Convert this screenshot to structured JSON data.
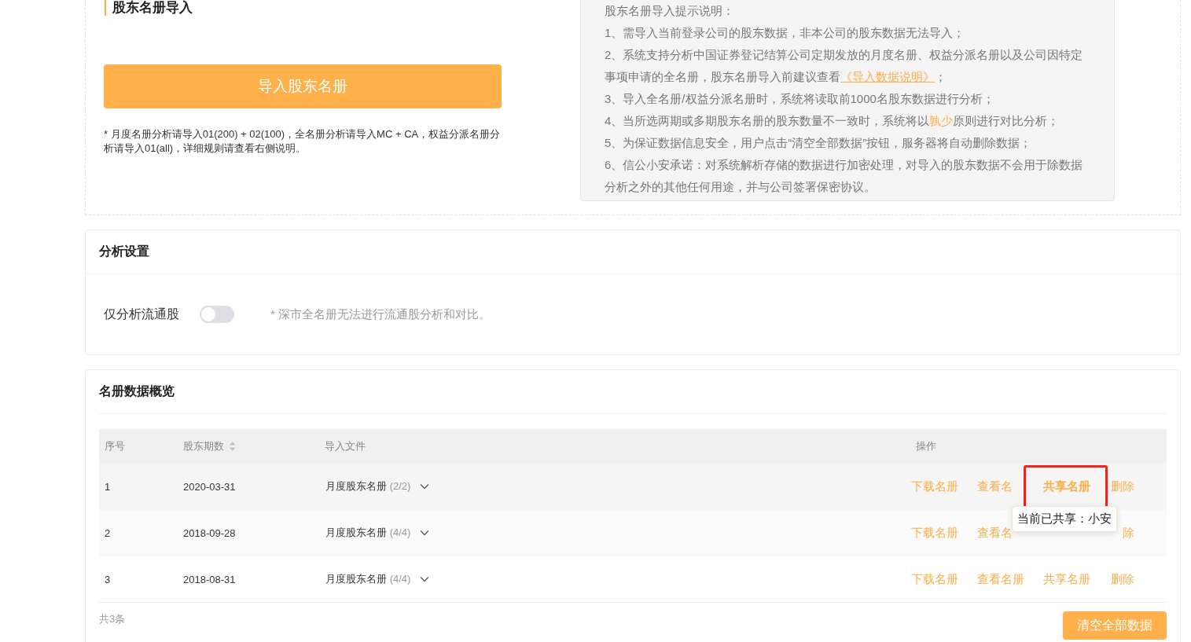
{
  "import_section": {
    "title": "股东名册导入",
    "button": "导入股东名册",
    "note": "* 月度名册分析请导入01(200) + 02(100)，全名册分析请导入MC + CA，权益分派名册分析请导入01(all)，详细规则请查看右侧说明。"
  },
  "instructions": {
    "heading": "股东名册导入提示说明：",
    "items": [
      {
        "segments": [
          {
            "kind": "plain",
            "text": "1、需导入当前登录公司的股东数据，非本公司的股东数据无法导入；"
          }
        ]
      },
      {
        "segments": [
          {
            "kind": "plain",
            "text": "2、系统支持分析中国证券登记结算公司定期发放的月度名册、权益分派名册以及公司因特定事项申请的全名册，股东名册导入前建议查看"
          },
          {
            "kind": "link",
            "text": "《导入数据说明》"
          },
          {
            "kind": "plain",
            "text": "；"
          }
        ]
      },
      {
        "segments": [
          {
            "kind": "plain",
            "text": "3、导入全名册/权益分派名册时，系统将读取前1000名股东数据进行分析；"
          }
        ]
      },
      {
        "segments": [
          {
            "kind": "plain",
            "text": "4、当所选两期或多期股东名册的股东数量不一致时，系统将以"
          },
          {
            "kind": "highlight",
            "text": "孰少"
          },
          {
            "kind": "plain",
            "text": "原则进行对比分析；"
          }
        ]
      },
      {
        "segments": [
          {
            "kind": "plain",
            "text": "5、为保证数据信息安全，用户点击“清空全部数据”按钮，服务器将自动删除数据；"
          }
        ]
      },
      {
        "segments": [
          {
            "kind": "plain",
            "text": "6、信公小安承诺：对系统解析存储的数据进行加密处理，对导入的股东数据不会用于除数据分析之外的其他任何用途，并与公司签署保密协议。"
          }
        ]
      }
    ]
  },
  "analysis_settings": {
    "title": "分析设置",
    "toggle": {
      "label": "仅分析流通股",
      "on": false
    },
    "note": "* 深市全名册无法进行流通股分析和对比。"
  },
  "overview": {
    "title": "名册数据概览",
    "columns": [
      {
        "label": "序号",
        "sortable": false
      },
      {
        "label": "股东期数",
        "sortable": true
      },
      {
        "label": "导入文件",
        "sortable": false
      },
      {
        "label": "操作",
        "sortable": false
      }
    ],
    "rows": [
      {
        "index": "1",
        "period": "2020-03-31",
        "file": {
          "name": "月度股东名册",
          "count": "(2/2)"
        },
        "actions": [
          {
            "label": "下载名册",
            "highlighted": false
          },
          {
            "label": "查看名",
            "highlighted": false
          },
          {
            "label": "共享名册",
            "highlighted": true,
            "tooltip": "当前已共享：小安"
          },
          {
            "label": "删除",
            "highlighted": false
          }
        ]
      },
      {
        "index": "2",
        "period": "2018-09-28",
        "file": {
          "name": "月度股东名册",
          "count": "(4/4)"
        },
        "actions": [
          {
            "label": "下载名册",
            "highlighted": false
          },
          {
            "label": "查看名",
            "highlighted": false
          },
          {
            "label": "除",
            "highlighted": false
          }
        ]
      },
      {
        "index": "3",
        "period": "2018-08-31",
        "file": {
          "name": "月度股东名册",
          "count": "(4/4)"
        },
        "actions": [
          {
            "label": "下载名册",
            "highlighted": false
          },
          {
            "label": "查看名册",
            "highlighted": false
          },
          {
            "label": "共享名册",
            "highlighted": false
          },
          {
            "label": "删除",
            "highlighted": false
          }
        ]
      }
    ],
    "total": "共3条",
    "clear_button": "清空全部数据"
  }
}
